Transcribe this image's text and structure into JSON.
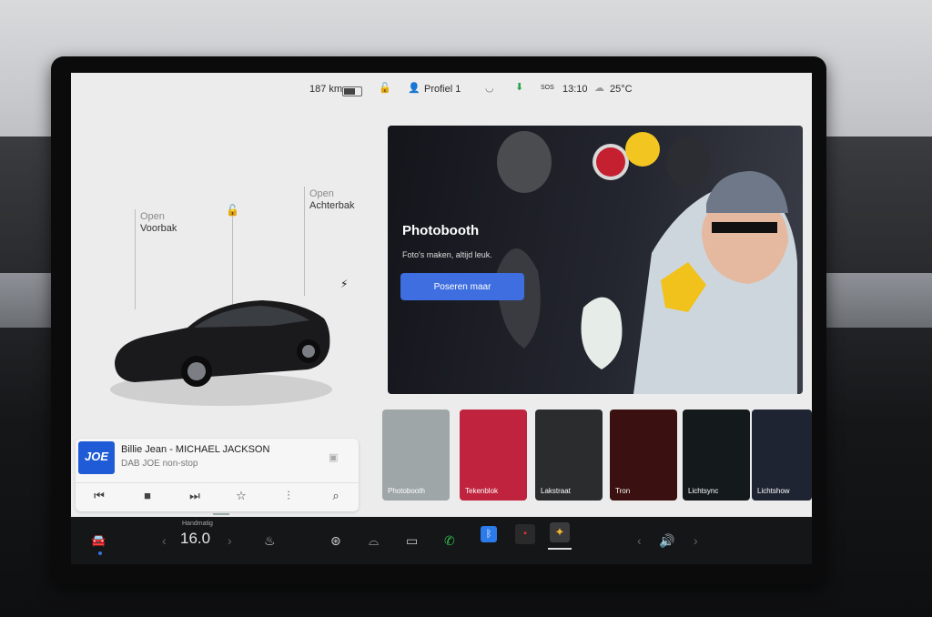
{
  "status": {
    "range": "187 km",
    "profile": "Profiel 1",
    "sos": "SOS",
    "time": "13:10",
    "temperature": "25°C"
  },
  "car": {
    "frunk_state": "Open",
    "frunk_label": "Voorbak",
    "trunk_state": "Open",
    "trunk_label": "Achterbak"
  },
  "media": {
    "logo": "JOE",
    "song": "Billie Jean - MICHAEL JACKSON",
    "station": "DAB JOE non-stop"
  },
  "photobooth": {
    "title": "Photobooth",
    "subtitle": "Foto's maken, altijd leuk.",
    "button": "Poseren maar"
  },
  "apps": [
    {
      "label": "Photobooth",
      "color": "#9fa6a8"
    },
    {
      "label": "Tekenblok",
      "color": "#c0233e"
    },
    {
      "label": "Lakstraat",
      "color": "#2a2c2e"
    },
    {
      "label": "Tron",
      "color": "#3a1010"
    },
    {
      "label": "Lichtsync",
      "color": "#141a1c"
    },
    {
      "label": "Lichtshow",
      "color": "#1f2433"
    }
  ],
  "climate": {
    "mode": "Handmatig",
    "temp": "16.0"
  }
}
